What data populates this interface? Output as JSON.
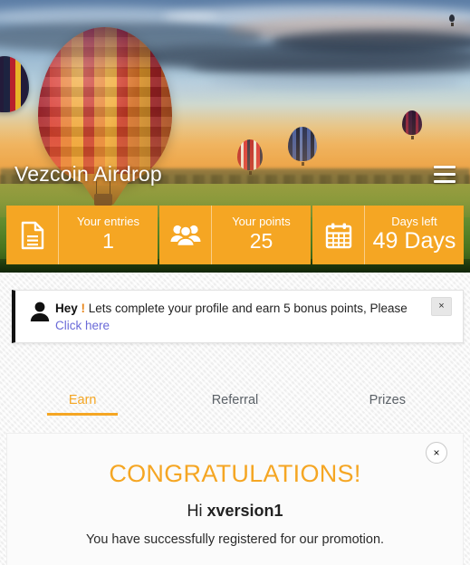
{
  "hero": {
    "title": "Vezcoin Airdrop",
    "menu_icon": "hamburger-menu-icon"
  },
  "stats": [
    {
      "icon": "document-icon",
      "label": "Your entries",
      "value": "1"
    },
    {
      "icon": "users-group-icon",
      "label": "Your points",
      "value": "25"
    },
    {
      "icon": "calendar-icon",
      "label": "Days left",
      "value": "49 Days"
    }
  ],
  "alert": {
    "icon": "user-avatar-icon",
    "lead": "Hey ",
    "bang": "!",
    "message": " Lets complete your profile and earn 5 bonus points, Please",
    "link": "Click here",
    "close_label": "×"
  },
  "tabs": [
    {
      "label": "Earn",
      "active": true
    },
    {
      "label": "Referral",
      "active": false
    },
    {
      "label": "Prizes",
      "active": false
    }
  ],
  "card": {
    "close_label": "×",
    "congrats": "CONGRATULATIONS!",
    "greet_prefix": "Hi ",
    "username": "xversion1",
    "subtext": "You have successfully registered for our promotion."
  },
  "colors": {
    "accent": "#f5a623",
    "link": "#6a6ad8",
    "tab_inactive": "#5b6167",
    "alert_border": "#111111"
  }
}
